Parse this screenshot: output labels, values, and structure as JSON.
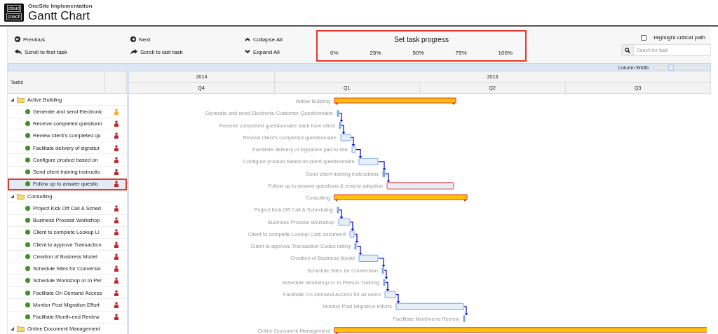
{
  "app": {
    "subtitle": "OneSite Implementation",
    "title": "Gantt Chart",
    "logo_top": "cloud",
    "logo_bottom": "coach"
  },
  "toolbar": {
    "previous": "Previous",
    "next": "Next",
    "collapse": "Collapse All",
    "scroll_first": "Scroll to first task",
    "scroll_last": "Scroll to last task",
    "expand": "Expand All",
    "progress": {
      "title": "Set task progress",
      "steps": [
        "0%",
        "25%",
        "50%",
        "75%",
        "100%"
      ]
    },
    "critical_path": {
      "label": "Highlight critical path",
      "checked": false
    },
    "search": {
      "placeholder": "Seach for task"
    }
  },
  "column_width": {
    "label": "Column Width",
    "level": 0.33
  },
  "task_header": "Tasks",
  "timeline": {
    "years": [
      "2014",
      "2015"
    ],
    "quarters": [
      "Q4",
      "Q1",
      "Q2",
      "Q3"
    ]
  },
  "rows": [
    {
      "kind": "group",
      "name": "Active Building",
      "label": "Active Building",
      "expanded": true,
      "selected": false
    },
    {
      "kind": "task",
      "name": "Generate and send Electronic",
      "label": "Generate and send Electronic Customer Questionnaire",
      "color": "#f0b030",
      "selected": false
    },
    {
      "kind": "task",
      "name": "Receive completed questionn",
      "label": "Receive completed questionnaire back from client",
      "color": "#c0282d",
      "selected": false
    },
    {
      "kind": "task",
      "name": "Review client’s completed qu",
      "label": "Review client’s completed questionnaire",
      "color": "#c0282d",
      "selected": false
    },
    {
      "kind": "task",
      "name": "Facilitate delivery of signatur",
      "label": "Facilitate delivery of signature pad to site",
      "color": "#c0282d",
      "selected": false
    },
    {
      "kind": "task",
      "name": "Configure product based on",
      "label": "Configure product based on client questionnaire",
      "color": "#c0282d",
      "selected": false
    },
    {
      "kind": "task",
      "name": "Send client training instructio",
      "label": "Send client training instructions",
      "color": "#c0282d",
      "selected": false
    },
    {
      "kind": "critical",
      "name": "Follow up to answer questio",
      "label": "Follow up to answer questions & ensure adoption",
      "color": "#c0282d",
      "selected": true
    },
    {
      "kind": "group",
      "name": "Consulting",
      "label": "Consulting",
      "expanded": true,
      "selected": false
    },
    {
      "kind": "task",
      "name": "Project Kick Off Call & Sched",
      "label": "Project Kick Off Call & Scheduling",
      "color": "#c0282d",
      "selected": false
    },
    {
      "kind": "task",
      "name": "Business Process Workshop",
      "label": "Business Process Workshop",
      "color": "#c0282d",
      "selected": false
    },
    {
      "kind": "task",
      "name": "Client to complete Lookup Li",
      "label": "Client to complete Lookup Lists document",
      "color": "#c0282d",
      "selected": false
    },
    {
      "kind": "task",
      "name": "Client to approve Transaction",
      "label": "Client to approve Transaction Codes listing",
      "color": "#c0282d",
      "selected": false
    },
    {
      "kind": "task",
      "name": "Creation of Business Model",
      "label": "Creation of Business Model",
      "color": "#c0282d",
      "selected": false
    },
    {
      "kind": "task",
      "name": "Schedule Sites for Conversio",
      "label": "Schedule Sites for Conversion",
      "color": "#c0282d",
      "selected": false
    },
    {
      "kind": "task",
      "name": "Schedule Workshop or In Per",
      "label": "Schedule Workshop or In Person Training",
      "color": "#c0282d",
      "selected": false
    },
    {
      "kind": "task",
      "name": "Facilitate On Demand Access",
      "label": "Facilitate On Demand Access for all users",
      "color": "#c0282d",
      "selected": false
    },
    {
      "kind": "task",
      "name": "Monitor Post Migration Effort",
      "label": "Monitor Post Migration Efforts",
      "color": "#c0282d",
      "selected": false
    },
    {
      "kind": "task",
      "name": "Facilitate Month-end Review",
      "label": "Facilitate Month-end Review",
      "color": "#c0282d",
      "selected": false
    },
    {
      "kind": "group",
      "name": "Online Document Management",
      "label": "Online Document Management",
      "expanded": true,
      "selected": false
    }
  ]
}
